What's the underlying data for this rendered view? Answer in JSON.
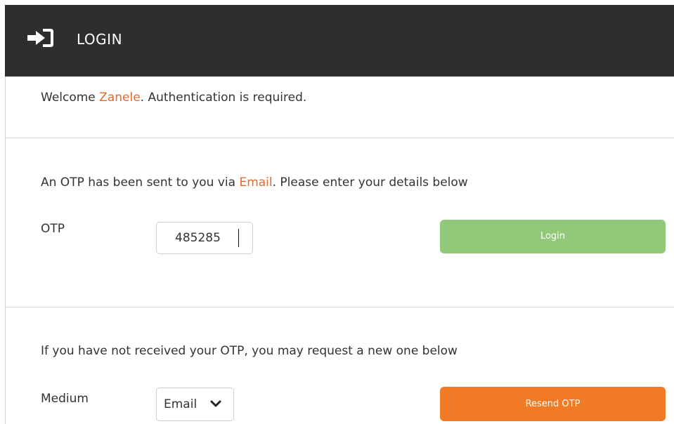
{
  "header": {
    "icon": "sign-in-icon",
    "title": "LOGIN"
  },
  "welcome": {
    "prefix": "Welcome ",
    "user_name": "Zanele",
    "suffix": ". Authentication is required."
  },
  "otp_section": {
    "prefix": "An OTP has been sent to you via ",
    "channel": "Email",
    "suffix": ". Please enter your details below",
    "otp_label": "OTP",
    "otp_value": "485285",
    "login_button": "Login"
  },
  "resend_section": {
    "instruction": "If you have not received your OTP, you may request a new one below",
    "medium_label": "Medium",
    "medium_selected": "Email",
    "medium_icon": "chevron-down-icon",
    "resend_button": "Resend OTP"
  },
  "colors": {
    "header_bg": "#2e2e2e",
    "accent": "#e8672c",
    "login_button": "#91c879",
    "resend_button": "#f07a26"
  }
}
